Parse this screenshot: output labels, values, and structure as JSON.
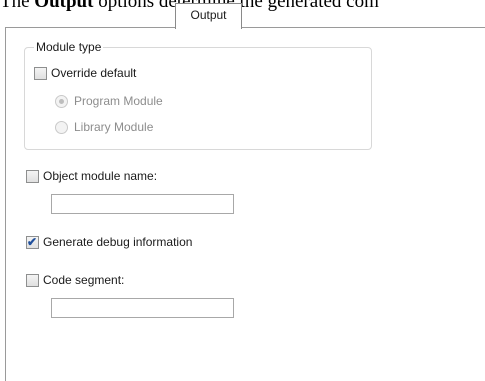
{
  "caption": {
    "prefix": "The ",
    "bold": "Output",
    "suffix": " options determine the generated com"
  },
  "tab": {
    "label": "Output"
  },
  "module_type": {
    "title": "Module type",
    "override_default": {
      "label": "Override default",
      "checked": false
    },
    "options": [
      {
        "label": "Program Module",
        "selected": true,
        "disabled": true
      },
      {
        "label": "Library Module",
        "selected": false,
        "disabled": true
      }
    ]
  },
  "object_module_name": {
    "label": "Object module name:",
    "checked": false,
    "value": ""
  },
  "generate_debug": {
    "label": "Generate debug information",
    "checked": true
  },
  "code_segment": {
    "label": "Code segment:",
    "checked": false,
    "value": ""
  }
}
